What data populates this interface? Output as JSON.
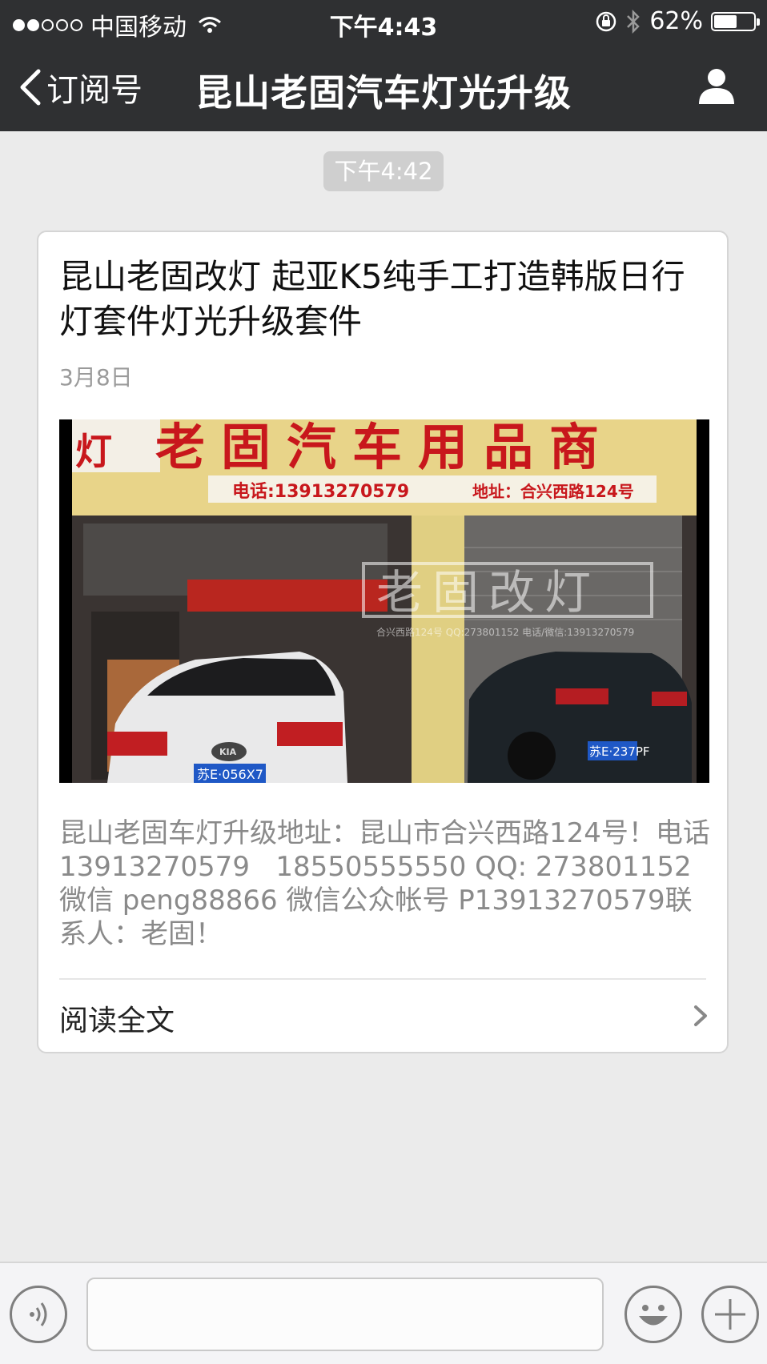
{
  "status_bar": {
    "carrier": "中国移动",
    "time": "下午4:43",
    "battery_text": "62%",
    "battery_level": 0.62
  },
  "nav": {
    "back_label": "订阅号",
    "title": "昆山老固汽车灯光升级"
  },
  "chat": {
    "timestamp": "下午4:42"
  },
  "article": {
    "title": "昆山老固改灯 起亚K5纯手工打造韩版日行灯套件灯光升级套件",
    "date": "3月8日",
    "image": {
      "shop_sign": "老固汽车用品商",
      "sign_left": "灯",
      "phone_banner": "电话:13913270579",
      "address_banner": "地址：合兴西路124号",
      "watermark": "老固改灯",
      "watermark_sub": "合兴西路124号 QQ:273801152 电话/微信:13913270579",
      "plate_left": "苏E·056X7",
      "plate_right": "苏E·237PF",
      "brand_badge": "KIA"
    },
    "summary": "昆山老固车灯升级地址：昆山市合兴西路124号！电话13913270579   18550555550 QQ: 273801152 微信 peng88866 微信公众帐号 P13913270579联系人：老固！",
    "read_more": "阅读全文"
  },
  "input_bar": {
    "placeholder": ""
  },
  "icons": {
    "back": "chevron-left-icon",
    "profile": "user-icon",
    "voice": "voice-icon",
    "emoji": "smiley-icon",
    "plus": "plus-icon",
    "wifi": "wifi-icon",
    "bluetooth": "bluetooth-icon",
    "rotation_lock": "rotation-lock-icon",
    "battery": "battery-icon"
  },
  "colors": {
    "bar_bg": "#2f3032",
    "page_bg": "#ebebeb",
    "chip_bg": "#cfcfcf",
    "sign_red": "#c8171c",
    "sign_yellow": "#e6d488"
  }
}
